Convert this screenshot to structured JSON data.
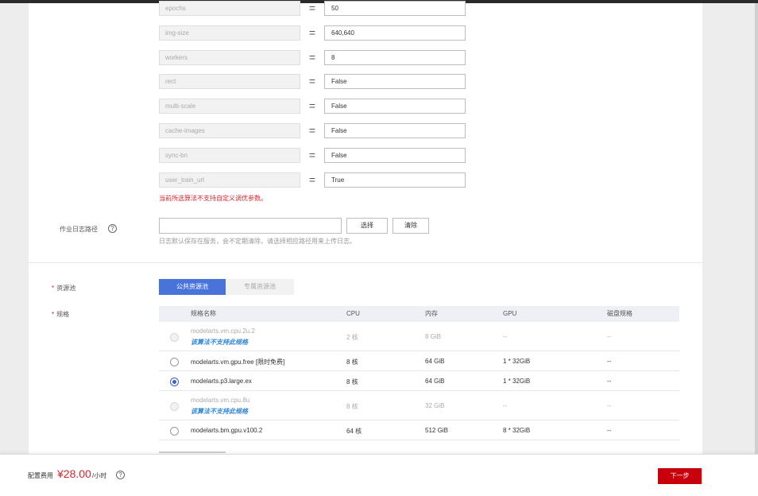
{
  "params": [
    {
      "name": "epochs",
      "value": "50"
    },
    {
      "name": "img-size",
      "value": "640,640"
    },
    {
      "name": "workers",
      "value": "8"
    },
    {
      "name": "rect",
      "value": "False"
    },
    {
      "name": "multi-scale",
      "value": "False"
    },
    {
      "name": "cache-images",
      "value": "False"
    },
    {
      "name": "sync-bn",
      "value": "False"
    },
    {
      "name": "user_train_url",
      "value": "True"
    }
  ],
  "equals_sign": "=",
  "param_warning": "当前所选算法不支持自定义调优参数。",
  "log_path": {
    "label": "作业日志路径",
    "help_icon": "?",
    "value": "",
    "select_label": "选择",
    "clear_label": "清除",
    "hint": "日志默认保存在服务，会不定期清除，请选择相应路径用来上传日志。"
  },
  "resource_pool": {
    "label": "资源池",
    "required_mark": "*",
    "tabs": [
      {
        "label": "公共资源池",
        "active": true
      },
      {
        "label": "专属资源池",
        "active": false
      }
    ]
  },
  "spec": {
    "label": "规格",
    "required_mark": "*",
    "columns": [
      "规格名称",
      "CPU",
      "内存",
      "GPU",
      "磁盘规格"
    ],
    "rows": [
      {
        "name": "modelarts.vm.cpu.2u.2",
        "note": "该算法不支持此规格",
        "cpu": "2 核",
        "memory": "8 GiB",
        "gpu": "--",
        "disk": "--",
        "disabled": true,
        "selected": false
      },
      {
        "name": "modelarts.vm.gpu.free [限时免费]",
        "note": "",
        "cpu": "8 核",
        "memory": "64 GiB",
        "gpu": "1 * 32GiB",
        "disk": "--",
        "disabled": false,
        "selected": false
      },
      {
        "name": "modelarts.p3.large.ex",
        "note": "",
        "cpu": "8 核",
        "memory": "64 GiB",
        "gpu": "1 * 32GiB",
        "disk": "--",
        "disabled": false,
        "selected": true
      },
      {
        "name": "modelarts.vm.cpu.8u",
        "note": "该算法不支持此规格",
        "cpu": "8 核",
        "memory": "32 GiB",
        "gpu": "--",
        "disk": "--",
        "disabled": true,
        "selected": false
      },
      {
        "name": "modelarts.bm.gpu.v100.2",
        "note": "",
        "cpu": "64 核",
        "memory": "512 GiB",
        "gpu": "8 * 32GiB",
        "disk": "--",
        "disabled": false,
        "selected": false
      }
    ]
  },
  "footer": {
    "fee_label": "配置费用",
    "price": "¥28.00",
    "unit": "/小时",
    "help_icon": "?",
    "next_label": "下一步"
  },
  "colors": {
    "accent": "#4a73d9",
    "primary_button": "#c7000b",
    "warning_text": "#d9232d",
    "link_note": "#2f86d6"
  }
}
